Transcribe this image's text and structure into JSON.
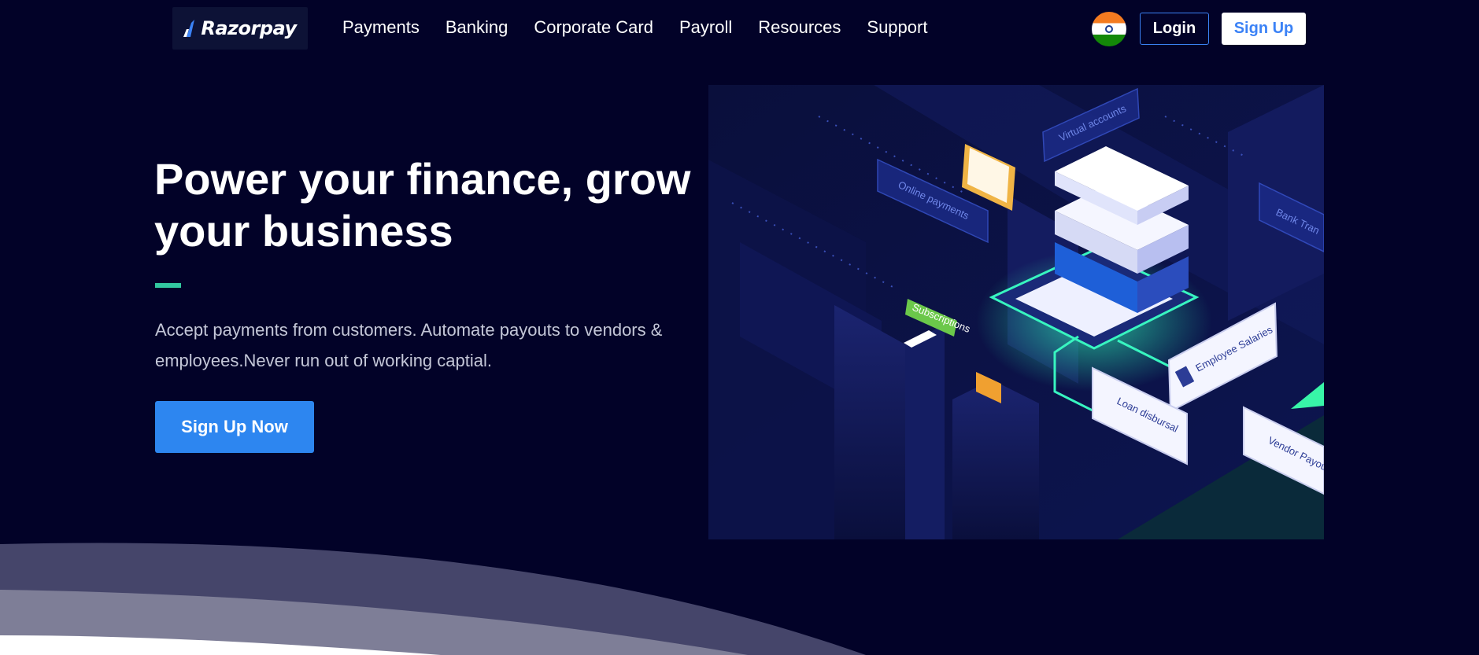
{
  "brand": {
    "name": "Razorpay"
  },
  "nav": {
    "items": [
      {
        "label": "Payments"
      },
      {
        "label": "Banking"
      },
      {
        "label": "Corporate Card"
      },
      {
        "label": "Payroll"
      },
      {
        "label": "Resources"
      },
      {
        "label": "Support"
      }
    ],
    "login_label": "Login",
    "signup_label": "Sign Up"
  },
  "hero": {
    "title_line1": "Power your finance, grow",
    "title_line2": "your business",
    "subtitle_line1": "Accept payments from customers. Automate payouts to vendors &",
    "subtitle_line2": "employees.Never run out of working captial.",
    "cta_label": "Sign Up Now"
  },
  "illustration": {
    "labels": {
      "virtual_accounts": "Virtual accounts",
      "online_payments": "Online payments",
      "bank_transfers": "Bank Tran",
      "subscriptions": "Subscriptions",
      "employee_salaries": "Employee Salaries",
      "loan_disbursal": "Loan disbursal",
      "vendor_payouts": "Vendor Payou"
    }
  },
  "colors": {
    "background": "#020228",
    "primary": "#2d86f0",
    "accent": "#32c8a0",
    "login_border": "#3b82f6"
  }
}
